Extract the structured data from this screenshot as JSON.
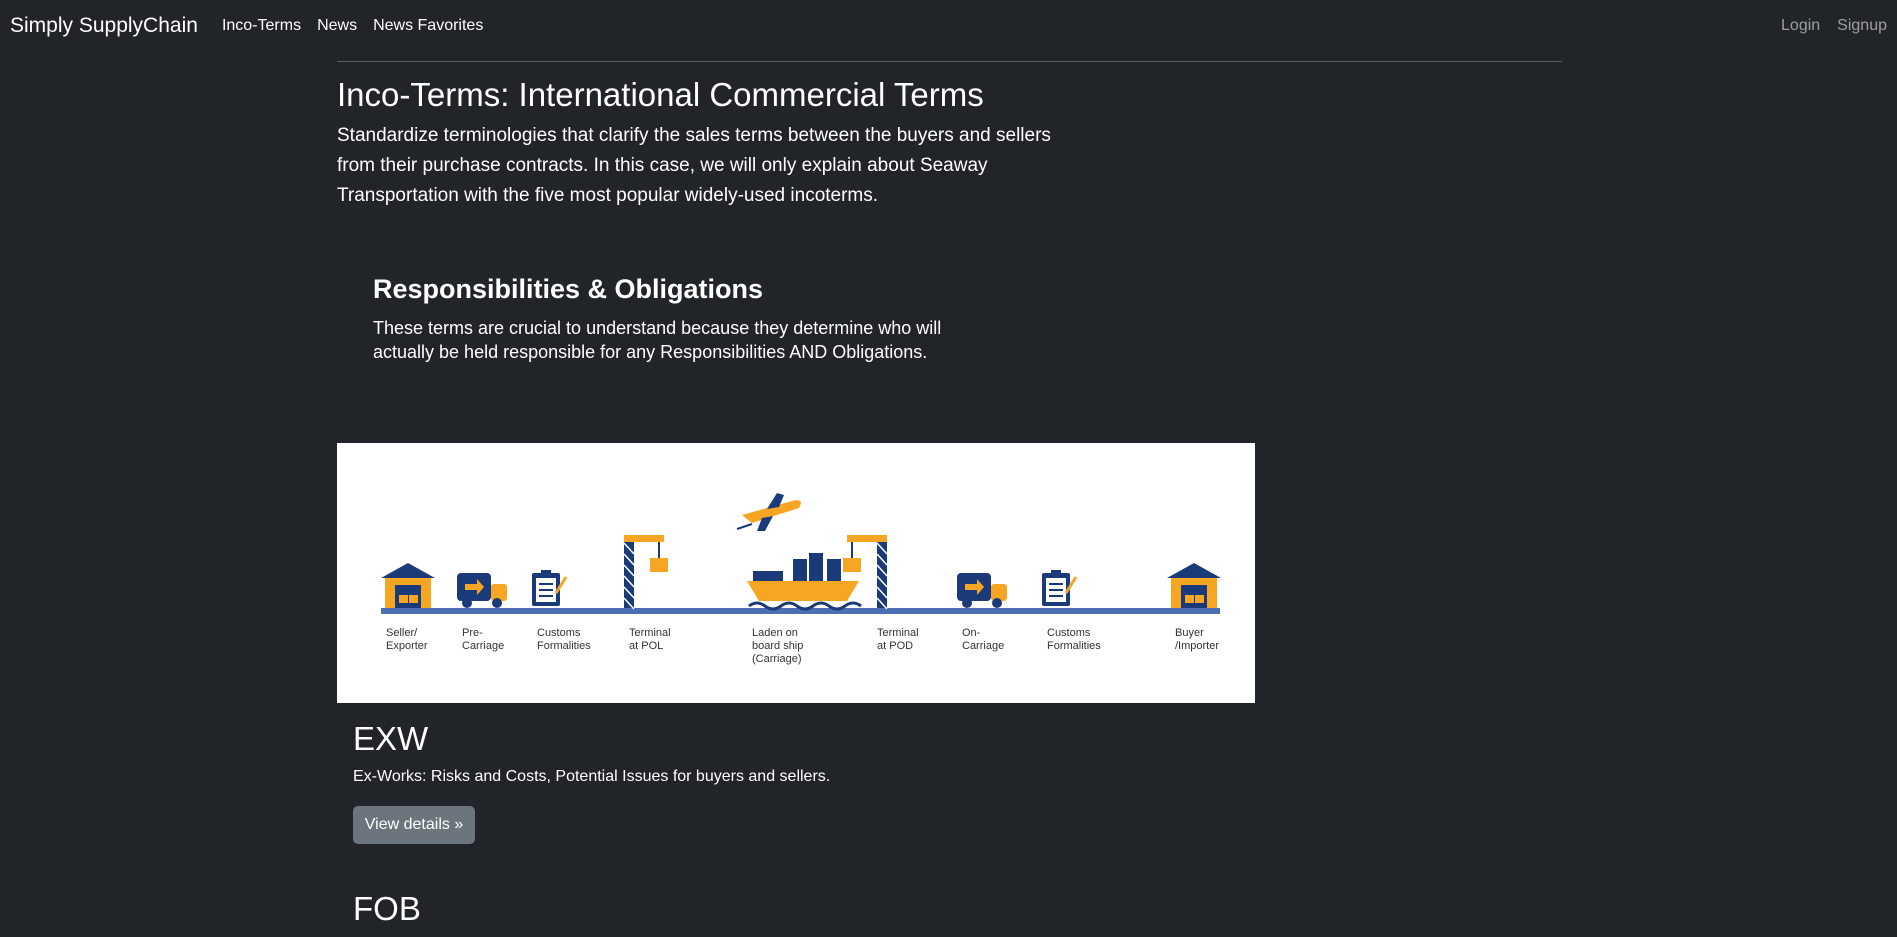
{
  "navbar": {
    "brand": "Simply SupplyChain",
    "links": [
      "Inco-Terms",
      "News",
      "News Favorites"
    ],
    "login": "Login",
    "signup": "Signup"
  },
  "intro": {
    "title": "Inco-Terms: International Commercial Terms",
    "lead": "Standardize terminologies that clarify the sales terms between the buyers and sellers from their purchase contracts. In this case, we will only explain about Seaway Transportation with the five most popular widely-used incoterms."
  },
  "responsibilities": {
    "title": "Responsibilities & Obligations",
    "text": "These terms are crucial to understand because they determine who will actually be held responsible for any Responsibilities AND Obligations."
  },
  "banner": {
    "colors": {
      "orange": "#f6a623",
      "navy": "#1a3a7a",
      "line": "#4a6fb5"
    },
    "stages": [
      {
        "lines": [
          "Seller/",
          "Exporter"
        ],
        "icon": "warehouse-icon"
      },
      {
        "lines": [
          "Pre-",
          "Carriage"
        ],
        "icon": "truck-icon"
      },
      {
        "lines": [
          "Customs",
          "Formalities"
        ],
        "icon": "clipboard-icon"
      },
      {
        "lines": [
          "Terminal",
          "at POL"
        ],
        "icon": "crane-icon"
      },
      {
        "lines": [
          "Laden on",
          "board ship",
          "(Carriage)"
        ],
        "icon": "ship-icon"
      },
      {
        "lines": [
          "Terminal",
          "at POD"
        ],
        "icon": "crane-icon"
      },
      {
        "lines": [
          "On-",
          "Carriage"
        ],
        "icon": "truck-icon"
      },
      {
        "lines": [
          "Customs",
          "Formalities"
        ],
        "icon": "clipboard-icon"
      },
      {
        "lines": [
          "Buyer",
          "/Importer"
        ],
        "icon": "warehouse-icon"
      }
    ],
    "airplane_icon": "airplane-icon"
  },
  "terms": [
    {
      "code": "EXW",
      "description": "Ex-Works: Risks and Costs, Potential Issues for buyers and sellers.",
      "button": "View details »"
    },
    {
      "code": "FOB"
    }
  ]
}
